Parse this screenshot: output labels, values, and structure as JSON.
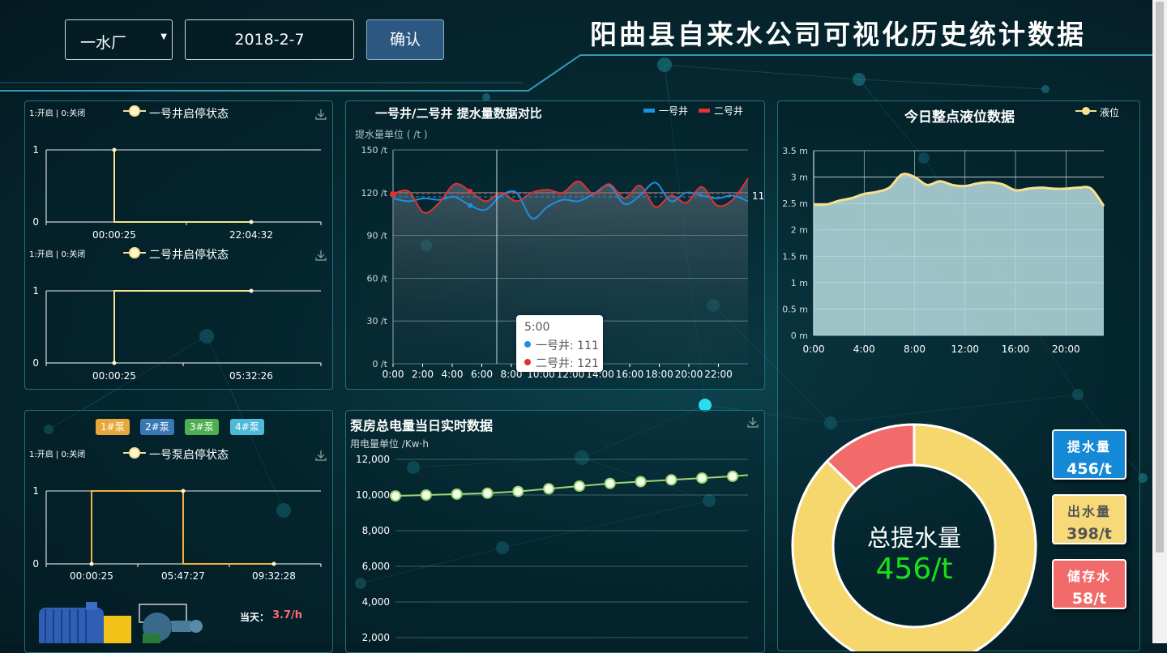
{
  "header": {
    "plant_select": "一水厂",
    "date_value": "2018-2-7",
    "confirm_label": "确认",
    "title": "阳曲县自来水公司可视化历史统计数据"
  },
  "well1_status": {
    "unit_note": "1:开启 | 0:关闭",
    "legend": "一号井启停状态",
    "y_ticks": [
      "1",
      "0"
    ],
    "x_ticks": [
      "00:00:25",
      "22:04:32"
    ],
    "chart_data": {
      "type": "line",
      "step": true,
      "x": [
        "00:00:25",
        "00:00:25",
        "22:04:32"
      ],
      "y": [
        1,
        0,
        0
      ],
      "ylim": [
        0,
        1
      ]
    }
  },
  "well2_status": {
    "unit_note": "1:开启 | 0:关闭",
    "legend": "二号井启停状态",
    "y_ticks": [
      "1",
      "0"
    ],
    "x_ticks": [
      "00:00:25",
      "05:32:26"
    ],
    "chart_data": {
      "type": "line",
      "step": true,
      "x": [
        "00:00:25",
        "00:00:25",
        "05:32:26"
      ],
      "y": [
        0,
        1,
        1
      ],
      "ylim": [
        0,
        1
      ]
    }
  },
  "compare": {
    "title": "一号井/二号井 提水量数据对比",
    "legend": [
      "一号井",
      "二号井"
    ],
    "unit_label": "提水量单位 ( /t )",
    "y_ticks": [
      "150 /t",
      "120 /t",
      "90 /t",
      "60 /t",
      "30 /t",
      "0 /t"
    ],
    "x_ticks": [
      "0:00",
      "2:00",
      "4:00",
      "6:00",
      "8:00",
      "10:00",
      "12:00",
      "14:00",
      "16:00",
      "18:00",
      "20:00",
      "22:00"
    ],
    "avg_label": "11",
    "tooltip": {
      "time": "5:00",
      "s1": "一号井: 111",
      "s2": "二号井: 121"
    },
    "chart_data": {
      "type": "line",
      "x": [
        "0:00",
        "1:00",
        "2:00",
        "3:00",
        "4:00",
        "5:00",
        "6:00",
        "7:00",
        "8:00",
        "9:00",
        "10:00",
        "11:00",
        "12:00",
        "13:00",
        "14:00",
        "15:00",
        "16:00",
        "17:00",
        "18:00",
        "19:00",
        "20:00",
        "21:00",
        "22:00",
        "23:00"
      ],
      "series": [
        {
          "name": "一号井",
          "values": [
            116,
            114,
            116,
            115,
            117,
            111,
            108,
            118,
            120,
            102,
            110,
            115,
            114,
            119,
            125,
            112,
            118,
            127,
            114,
            120,
            118,
            116,
            118,
            114
          ]
        },
        {
          "name": "二号井",
          "values": [
            119,
            121,
            106,
            113,
            126,
            121,
            114,
            120,
            114,
            120,
            122,
            120,
            128,
            119,
            126,
            116,
            125,
            110,
            118,
            113,
            124,
            111,
            115,
            130
          ]
        }
      ],
      "ylim": [
        0,
        150
      ]
    },
    "colors": {
      "s1": "#1e90e0",
      "s2": "#e03232"
    }
  },
  "level": {
    "title": "今日整点液位数据",
    "legend": "液位",
    "y_ticks": [
      "3.5 m",
      "3 m",
      "2.5 m",
      "2 m",
      "1.5 m",
      "1 m",
      "0.5 m",
      "0 m"
    ],
    "x_ticks": [
      "0:00",
      "4:00",
      "8:00",
      "12:00",
      "16:00",
      "20:00"
    ],
    "chart_data": {
      "type": "area",
      "x": [
        0,
        1,
        2,
        3,
        4,
        5,
        6,
        7,
        8,
        9,
        10,
        11,
        12,
        13,
        14,
        15,
        16,
        17,
        18,
        19,
        20,
        21,
        22,
        23
      ],
      "values": [
        2.48,
        2.48,
        2.55,
        2.6,
        2.68,
        2.72,
        2.8,
        3.05,
        3.0,
        2.85,
        2.92,
        2.85,
        2.83,
        2.88,
        2.9,
        2.86,
        2.75,
        2.78,
        2.8,
        2.78,
        2.78,
        2.8,
        2.78,
        2.45
      ],
      "ylim": [
        0,
        3.5
      ]
    }
  },
  "pump": {
    "tags": [
      "1#泵",
      "2#泵",
      "3#泵",
      "4#泵"
    ],
    "tag_colors": [
      "#e8a73a",
      "#3a78b5",
      "#4caf50",
      "#4fb9d8"
    ],
    "unit_note": "1:开启 | 0:关闭",
    "legend": "一号泵启停状态",
    "y_ticks": [
      "1",
      "0"
    ],
    "x_ticks": [
      "00:00:25",
      "05:47:27",
      "09:32:28"
    ],
    "today_label": "当天：",
    "today_value": "3.7/h",
    "chart_data": {
      "type": "line",
      "step": true,
      "x": [
        "00:00:25",
        "00:00:25",
        "05:47:27",
        "05:47:27",
        "09:32:28"
      ],
      "y": [
        0,
        1,
        1,
        0,
        0
      ],
      "ylim": [
        0,
        1
      ]
    }
  },
  "power": {
    "title": "泵房总电量当日实时数据",
    "unit_label": "用电量单位 /Kw·h",
    "y_ticks": [
      "12,000",
      "10,000",
      "8,000",
      "6,000",
      "4,000",
      "2,000"
    ],
    "chart_data": {
      "type": "line",
      "x": [
        1,
        2,
        3,
        4,
        5,
        6,
        7,
        8,
        9,
        10,
        11,
        12
      ],
      "values": [
        9950,
        10000,
        10050,
        10100,
        10200,
        10350,
        10500,
        10650,
        10750,
        10850,
        10950,
        11050
      ],
      "ylim": [
        2000,
        12000
      ]
    }
  },
  "donut": {
    "center_label": "总提水量",
    "center_value": "456/t",
    "chart_data": {
      "type": "pie",
      "labels": [
        "出水量",
        "储存水"
      ],
      "values": [
        398,
        58
      ]
    },
    "colors": [
      "#f5d76e",
      "#f26b6b"
    ]
  },
  "stats": [
    {
      "label": "提水量",
      "value": "456/t",
      "bg": "#1588d6"
    },
    {
      "label": "出水量",
      "value": "398/t",
      "bg": "#f7d97a"
    },
    {
      "label": "储存水",
      "value": "58/t",
      "bg": "#f26b6b"
    }
  ]
}
